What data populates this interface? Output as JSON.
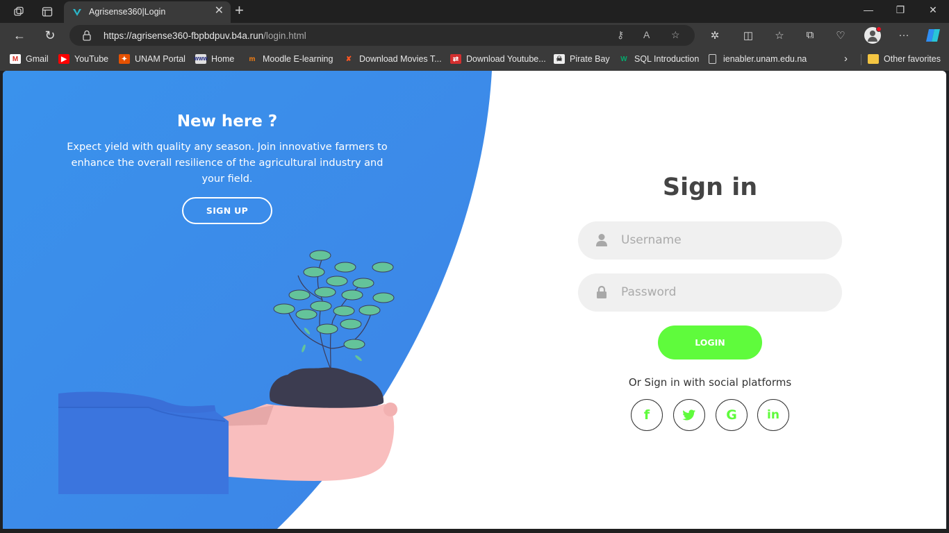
{
  "browser": {
    "tab_title": "Agrisense360|Login",
    "url_main": "https://agrisense360-fbpbdpuv.b4a.run",
    "url_path": "/login.html",
    "bookmarks": [
      {
        "label": "Gmail",
        "icon": "gmail-icon"
      },
      {
        "label": "YouTube",
        "icon": "youtube-icon"
      },
      {
        "label": "UNAM Portal",
        "icon": "unam-icon"
      },
      {
        "label": "Home",
        "icon": "home-icon"
      },
      {
        "label": "Moodle E-learning",
        "icon": "moodle-icon"
      },
      {
        "label": "Download Movies T...",
        "icon": "movies-icon"
      },
      {
        "label": "Download Youtube...",
        "icon": "download-icon"
      },
      {
        "label": "Pirate Bay",
        "icon": "piratebay-icon"
      },
      {
        "label": "SQL Introduction",
        "icon": "w3-icon"
      },
      {
        "label": "ienabler.unam.edu.na",
        "icon": "page-icon"
      }
    ],
    "other_favorites": "Other favorites"
  },
  "left_panel": {
    "title": "New here ?",
    "text": "Expect yield with quality any season. Join innovative farmers to enhance the overall resilience of the agricultural industry and your field.",
    "signup_label": "SIGN UP"
  },
  "signin": {
    "title": "Sign in",
    "username_placeholder": "Username",
    "password_placeholder": "Password",
    "login_label": "LOGIN",
    "social_text": "Or Sign in with social platforms",
    "social": [
      "f",
      "t",
      "G",
      "in"
    ]
  },
  "colors": {
    "primary_blue": "#3a8ee8",
    "accent_green": "#5ffb3c",
    "title_gray": "#444444"
  }
}
